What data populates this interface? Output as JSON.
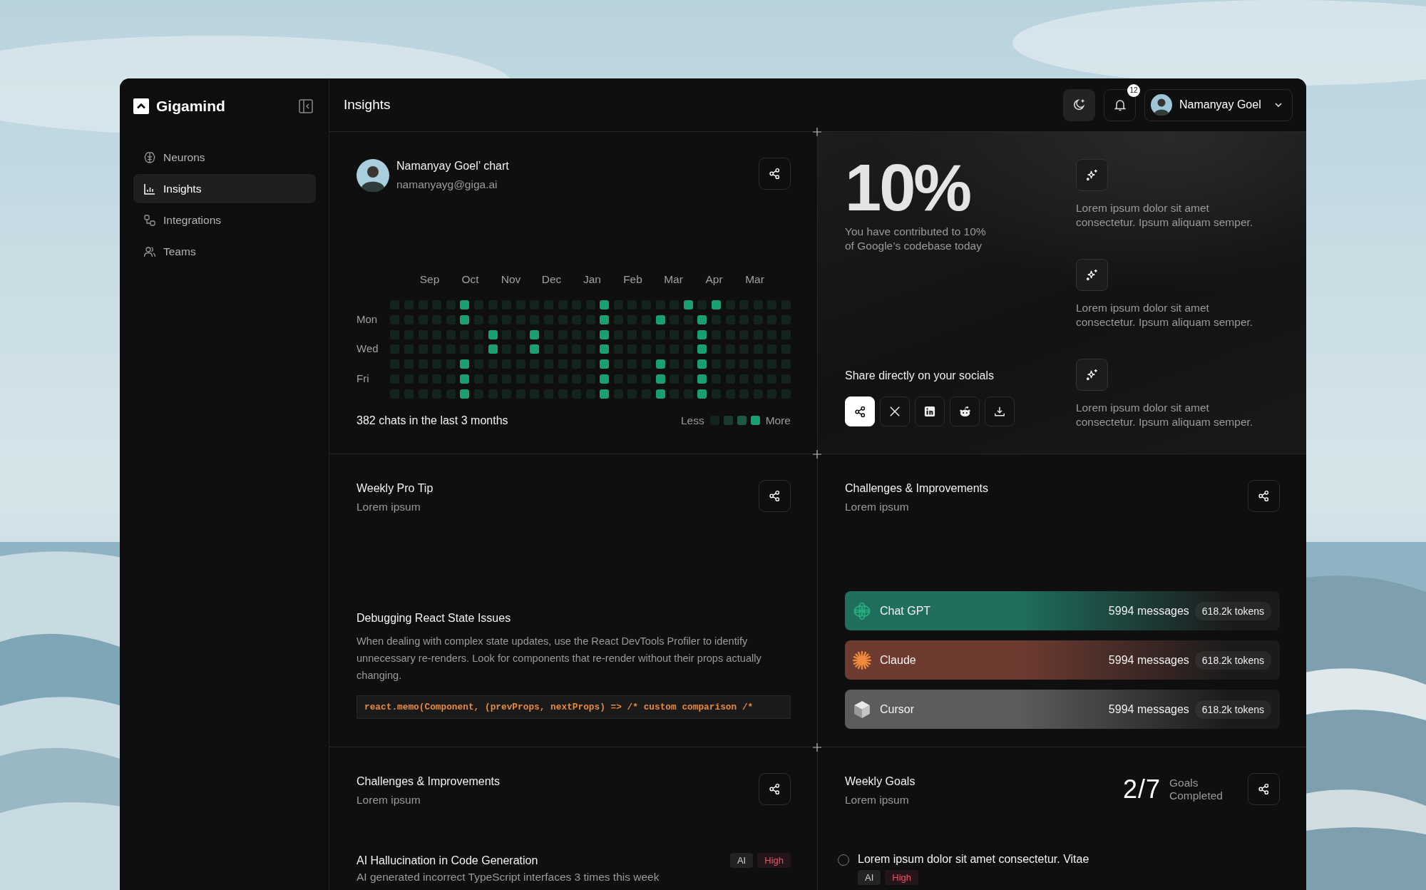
{
  "app": {
    "name": "Gigamind"
  },
  "sidebar": {
    "items": [
      {
        "label": "Neurons",
        "kind": "brain",
        "selected": false
      },
      {
        "label": "Insights",
        "kind": "chart",
        "selected": true
      },
      {
        "label": "Integrations",
        "kind": "nodes",
        "selected": false
      },
      {
        "label": "Teams",
        "kind": "users",
        "selected": false
      }
    ]
  },
  "header": {
    "title": "Insights",
    "notifications": "12",
    "user": "Namanyay Goel"
  },
  "activity": {
    "name": "Namanyay Goel’ chart",
    "email": "namanyayg@giga.ai",
    "months": [
      "Sep",
      "Oct",
      "Nov",
      "Dec",
      "Jan",
      "Feb",
      "Mar",
      "Apr",
      "Mar"
    ],
    "rows": [
      {
        "cells": [
          false,
          false,
          false,
          false,
          false,
          true,
          false,
          false,
          false,
          false,
          false,
          false,
          false,
          false,
          false,
          true,
          false,
          false,
          false,
          false,
          false,
          true,
          false,
          true,
          false,
          false,
          false,
          false,
          false
        ]
      },
      {
        "label": "Mon",
        "cells": [
          false,
          false,
          false,
          false,
          false,
          true,
          false,
          false,
          false,
          false,
          false,
          false,
          false,
          false,
          false,
          true,
          false,
          false,
          false,
          true,
          false,
          false,
          true,
          false,
          false,
          false,
          false,
          false,
          false
        ]
      },
      {
        "cells": [
          false,
          false,
          false,
          false,
          false,
          false,
          false,
          true,
          false,
          false,
          true,
          false,
          false,
          false,
          false,
          true,
          false,
          false,
          false,
          false,
          false,
          false,
          true,
          false,
          false,
          false,
          false,
          false,
          false
        ]
      },
      {
        "label": "Wed",
        "cells": [
          false,
          false,
          false,
          false,
          false,
          false,
          false,
          true,
          false,
          false,
          true,
          false,
          false,
          false,
          false,
          true,
          false,
          false,
          false,
          false,
          false,
          false,
          true,
          false,
          false,
          false,
          false,
          false,
          false
        ]
      },
      {
        "cells": [
          false,
          false,
          false,
          false,
          false,
          true,
          false,
          false,
          false,
          false,
          false,
          false,
          false,
          false,
          false,
          true,
          false,
          false,
          false,
          true,
          false,
          false,
          true,
          false,
          false,
          false,
          false,
          false,
          false
        ]
      },
      {
        "label": "Fri",
        "cells": [
          false,
          false,
          false,
          false,
          false,
          true,
          false,
          false,
          false,
          false,
          false,
          false,
          false,
          false,
          false,
          true,
          false,
          false,
          false,
          true,
          false,
          false,
          true,
          false,
          false,
          false,
          false,
          false,
          false
        ]
      },
      {
        "cells": [
          false,
          false,
          false,
          false,
          false,
          true,
          false,
          false,
          false,
          false,
          false,
          false,
          false,
          false,
          false,
          true,
          false,
          false,
          false,
          true,
          false,
          false,
          true,
          false,
          false,
          false,
          false,
          false,
          false
        ]
      }
    ],
    "summary": "382 chats in the last 3 months",
    "legend_less": "Less",
    "legend_more": "More"
  },
  "contribution": {
    "value": "10%",
    "description": "You have contributed to 10% of Google’s codebase today",
    "share_label": "Share directly on your socials",
    "share_buttons": [
      {
        "kind": "share",
        "selected": true
      },
      {
        "kind": "x",
        "selected": false
      },
      {
        "kind": "linkedin",
        "selected": false
      },
      {
        "kind": "reddit",
        "selected": false
      },
      {
        "kind": "download",
        "selected": false
      }
    ],
    "highlights": [
      {
        "text": "Lorem ipsum dolor sit amet consectetur. Ipsum aliquam semper."
      },
      {
        "text": "Lorem ipsum dolor sit amet consectetur. Ipsum aliquam semper."
      },
      {
        "text": "Lorem ipsum dolor sit amet consectetur. Ipsum aliquam semper."
      }
    ]
  },
  "pro_tip": {
    "title": "Weekly Pro Tip",
    "subtitle": "Lorem ipsum",
    "heading": "Debugging React State Issues",
    "body": "When dealing with complex state updates, use the React DevTools Profiler to identify unnecessary re-renders. Look for components that re-render without their props actually changing.",
    "code": "react.memo(Component, (prevProps, nextProps) => /* custom comparison /*"
  },
  "models": {
    "title": "Challenges & Improvements",
    "subtitle": "Lorem ipsum",
    "items": [
      {
        "kind": "chatgpt",
        "name": "Chat GPT",
        "messages": "5994 messages",
        "tokens": "618.2k tokens",
        "color": "#1f6e5e"
      },
      {
        "kind": "claude",
        "name": "Claude",
        "messages": "5994 messages",
        "tokens": "618.2k tokens",
        "color": "#6e3b31"
      },
      {
        "kind": "cursor",
        "name": "Cursor",
        "messages": "5994 messages",
        "tokens": "618.2k tokens",
        "color": "#5c5c5e"
      }
    ]
  },
  "challenges": {
    "title": "Challenges & Improvements",
    "subtitle": "Lorem ipsum",
    "items": [
      {
        "title": "AI Hallucination in Code Generation",
        "description": "AI generated incorrect TypeScript interfaces 3 times this week",
        "tags": [
          {
            "label": "AI",
            "kind": "category"
          },
          {
            "label": "High",
            "kind": "priority"
          }
        ]
      }
    ]
  },
  "goals": {
    "title": "Weekly Goals",
    "subtitle": "Lorem ipsum",
    "count": "2/7",
    "count_label": "Goals Completed",
    "items": [
      {
        "text": "Lorem ipsum dolor sit amet consectetur. Vitae",
        "checked": false,
        "tags": [
          {
            "label": "AI",
            "kind": "category"
          },
          {
            "label": "High",
            "kind": "priority"
          }
        ]
      }
    ]
  }
}
